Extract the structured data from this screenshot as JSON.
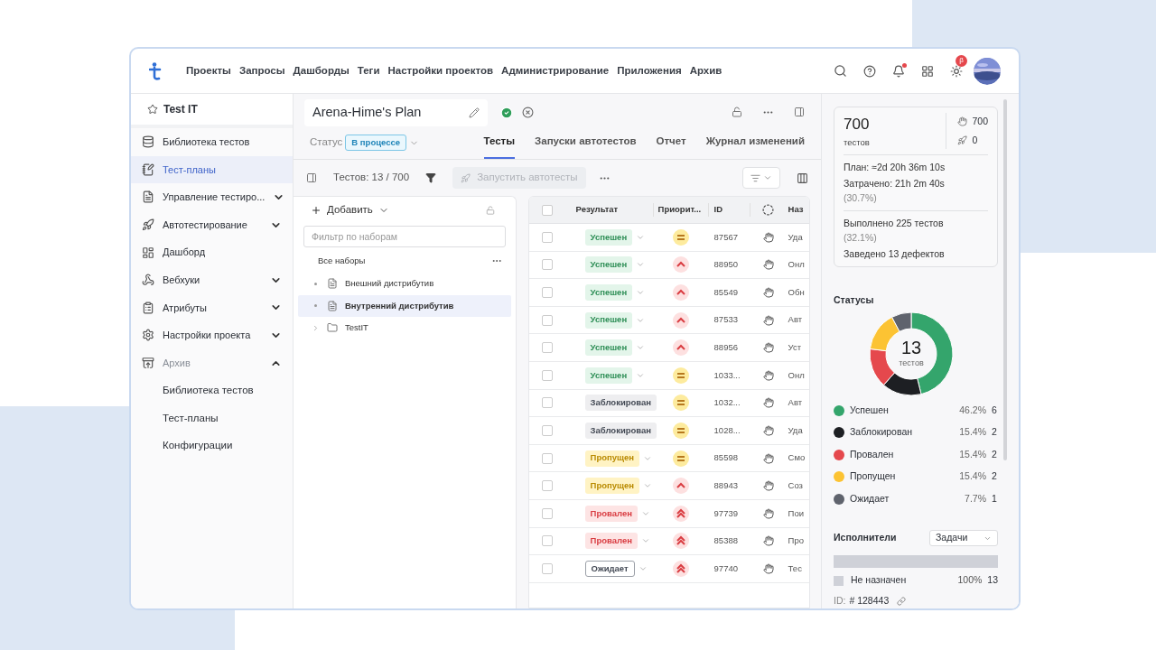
{
  "topbar": {
    "nav": [
      "Проекты",
      "Запросы",
      "Дашборды",
      "Теги",
      "Настройки проектов",
      "Администрирование",
      "Приложения",
      "Архив"
    ],
    "notification_dot": true,
    "beta_badge": "β"
  },
  "sidebar": {
    "project": "Test IT",
    "items": [
      {
        "kind": "library",
        "label": "Библиотека тестов",
        "selected": false
      },
      {
        "kind": "plans",
        "label": "Тест-планы",
        "selected": true
      },
      {
        "kind": "management",
        "label": "Управление тестиро...",
        "selected": false,
        "expanded": false
      },
      {
        "kind": "autotests",
        "label": "Автотестирование",
        "selected": false,
        "expanded": false
      },
      {
        "kind": "dashboard",
        "label": "Дашборд",
        "selected": false
      },
      {
        "kind": "webhooks",
        "label": "Вебхуки",
        "selected": false,
        "expanded": false
      },
      {
        "kind": "attributes",
        "label": "Атрибуты",
        "selected": false,
        "expanded": false
      },
      {
        "kind": "settings",
        "label": "Настройки проекта",
        "selected": false,
        "expanded": false
      },
      {
        "kind": "archive",
        "label": "Архив",
        "selected": false,
        "expanded": true,
        "disabled": true,
        "children": [
          {
            "label": "Библиотека тестов",
            "selected": false
          },
          {
            "label": "Тест-планы",
            "selected": false
          },
          {
            "label": "Конфигурации",
            "selected": false
          }
        ]
      }
    ]
  },
  "plan": {
    "title": "Arena-Hime's Plan",
    "status_label": "Статус",
    "status": "В процессе",
    "tabs": [
      {
        "label": "Тесты",
        "selected": true
      },
      {
        "label": "Запуски автотестов",
        "selected": false
      },
      {
        "label": "Отчет",
        "selected": false
      },
      {
        "label": "Журнал изменений",
        "selected": false
      }
    ]
  },
  "toolbar": {
    "count": "Тестов: 13 / 700",
    "run_button": {
      "label": "Запустить автотесты",
      "disabled": true
    }
  },
  "sets": {
    "add_label": "Добавить",
    "filter_placeholder": "Фильтр по наборам",
    "root": "Все наборы",
    "children": [
      {
        "label": "Внешний дистрибутив",
        "selected": false,
        "kind": "leaf"
      },
      {
        "label": "Внутренний дистрибутив",
        "selected": true,
        "kind": "leaf"
      },
      {
        "label": "TestIT",
        "selected": false,
        "expanded": false,
        "kind": "folder"
      }
    ]
  },
  "table": {
    "all_checked": false,
    "columns": [
      "Результат",
      "Приорит...",
      "ID",
      "Наз"
    ],
    "rows": [
      {
        "checked": false,
        "result": {
          "kind": "passed",
          "label": "Успешен"
        },
        "priority": {
          "kind": "medium"
        },
        "id": "87567",
        "name": "Уда"
      },
      {
        "checked": false,
        "result": {
          "kind": "passed",
          "label": "Успешен"
        },
        "priority": {
          "kind": "high"
        },
        "id": "88950",
        "name": "Онл"
      },
      {
        "checked": false,
        "result": {
          "kind": "passed",
          "label": "Успешен"
        },
        "priority": {
          "kind": "high"
        },
        "id": "85549",
        "name": "Обн"
      },
      {
        "checked": false,
        "result": {
          "kind": "passed",
          "label": "Успешен"
        },
        "priority": {
          "kind": "high"
        },
        "id": "87533",
        "name": "Авт"
      },
      {
        "checked": false,
        "result": {
          "kind": "passed",
          "label": "Успешен"
        },
        "priority": {
          "kind": "high"
        },
        "id": "88956",
        "name": "Уст"
      },
      {
        "checked": false,
        "result": {
          "kind": "passed",
          "label": "Успешен"
        },
        "priority": {
          "kind": "medium"
        },
        "id": "1033...",
        "name": "Онл"
      },
      {
        "checked": false,
        "result": {
          "kind": "blocked",
          "label": "Заблокирован"
        },
        "priority": {
          "kind": "medium"
        },
        "id": "1032...",
        "name": "Авт"
      },
      {
        "checked": false,
        "result": {
          "kind": "blocked",
          "label": "Заблокирован"
        },
        "priority": {
          "kind": "medium"
        },
        "id": "1028...",
        "name": "Уда"
      },
      {
        "checked": false,
        "result": {
          "kind": "skipped",
          "label": "Пропущен"
        },
        "priority": {
          "kind": "medium"
        },
        "id": "85598",
        "name": "Смо"
      },
      {
        "checked": false,
        "result": {
          "kind": "skipped",
          "label": "Пропущен"
        },
        "priority": {
          "kind": "high"
        },
        "id": "88943",
        "name": "Соз"
      },
      {
        "checked": false,
        "result": {
          "kind": "failed",
          "label": "Провален"
        },
        "priority": {
          "kind": "highest"
        },
        "id": "97739",
        "name": "Пои"
      },
      {
        "checked": false,
        "result": {
          "kind": "failed",
          "label": "Провален"
        },
        "priority": {
          "kind": "highest"
        },
        "id": "85388",
        "name": "Про"
      },
      {
        "checked": false,
        "result": {
          "kind": "waiting",
          "label": "Ожидает"
        },
        "priority": {
          "kind": "highest"
        },
        "id": "97740",
        "name": "Тес"
      }
    ]
  },
  "summary": {
    "total": "700",
    "total_label": "тестов",
    "manual": "700",
    "auto": "0",
    "plan": "План: ≈2d 20h 36m 10s",
    "spent": "Затрачено: 21h 2m 40s",
    "spent_pct": "(30.7%)",
    "done": "Выполнено 225 тестов",
    "done_pct": "(32.1%)",
    "defects": "Заведено 13 дефектов"
  },
  "statuses": {
    "title": "Статусы",
    "center_value": "13",
    "center_label": "тестов",
    "chart_data": {
      "type": "donut",
      "categories": [
        "Успешен",
        "Заблокирован",
        "Провален",
        "Пропущен",
        "Ожидает"
      ],
      "values": [
        46.2,
        15.4,
        15.4,
        15.4,
        7.7
      ]
    },
    "legend": [
      {
        "color": "#34a56c",
        "percent": "46.2%",
        "count": "6"
      },
      {
        "color": "#1d1f23",
        "percent": "15.4%",
        "count": "2"
      },
      {
        "color": "#e5484d",
        "percent": "15.4%",
        "count": "2"
      },
      {
        "color": "#fcc333",
        "percent": "15.4%",
        "count": "2"
      },
      {
        "color": "#5f636d",
        "percent": "7.7%",
        "count": "1"
      }
    ]
  },
  "assignees": {
    "title": "Исполнители",
    "dropdown": "Задачи",
    "level": 1,
    "items": [
      {
        "label": "Не назначен",
        "percent": "100%",
        "count": "13"
      }
    ]
  },
  "footer_id": {
    "label": "ID:",
    "value": "# 128443"
  }
}
